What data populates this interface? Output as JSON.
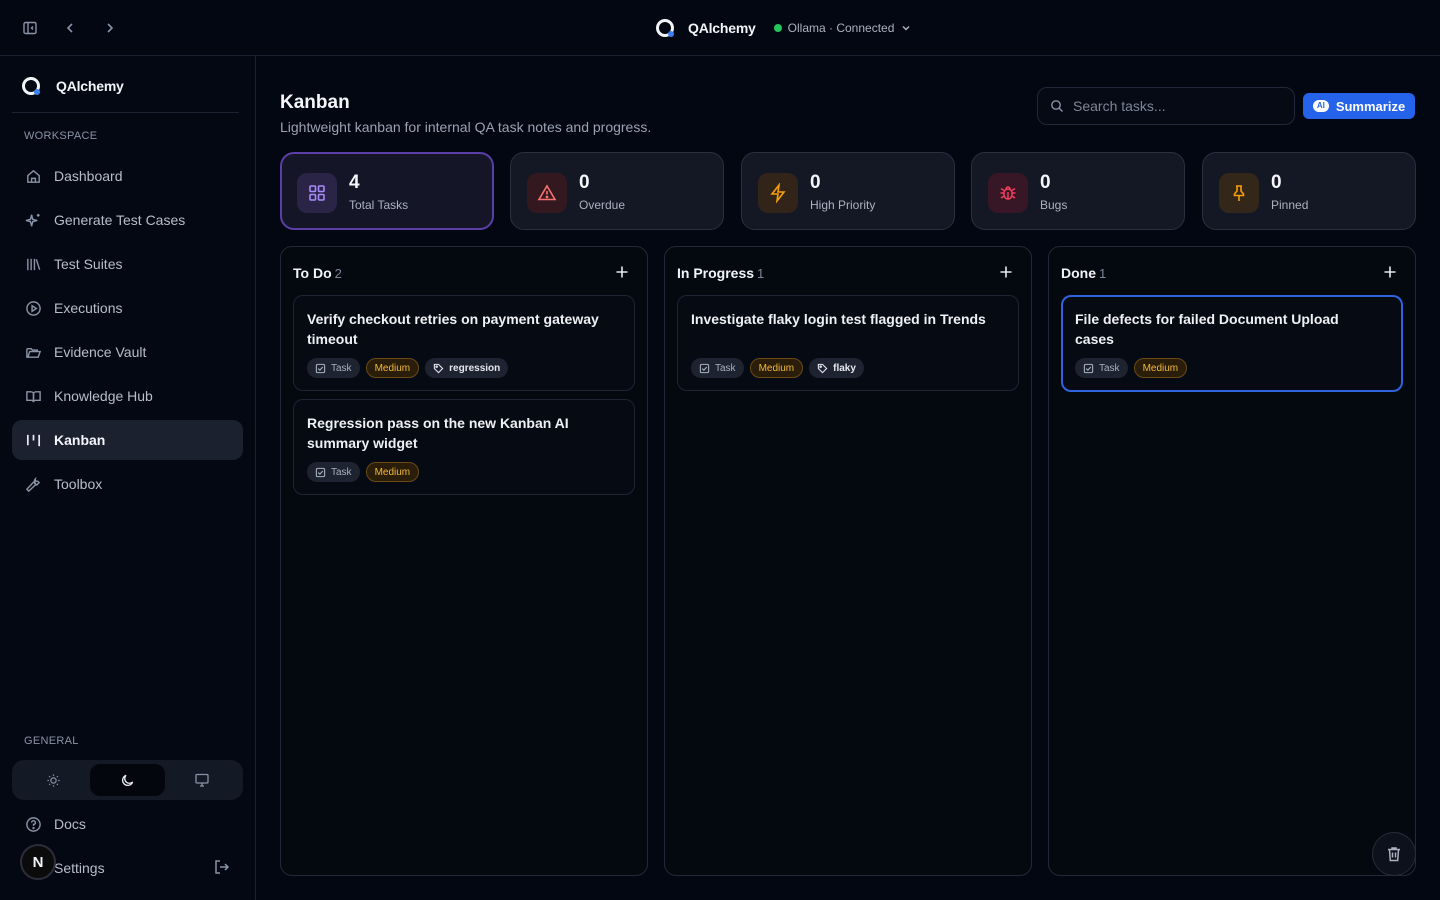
{
  "titlebar": {
    "app_name": "QAlchemy",
    "status": "Ollama · Connected"
  },
  "sidebar": {
    "brand": "QAlchemy",
    "workspace_label": "WORKSPACE",
    "items": [
      {
        "label": "Dashboard",
        "icon": "home-icon"
      },
      {
        "label": "Generate Test Cases",
        "icon": "sparkles-icon"
      },
      {
        "label": "Test Suites",
        "icon": "library-icon"
      },
      {
        "label": "Executions",
        "icon": "play-circle-icon"
      },
      {
        "label": "Evidence Vault",
        "icon": "folder-open-icon"
      },
      {
        "label": "Knowledge Hub",
        "icon": "book-open-icon"
      },
      {
        "label": "Kanban",
        "icon": "kanban-icon",
        "active": true
      },
      {
        "label": "Toolbox",
        "icon": "wrench-icon"
      }
    ],
    "general_label": "GENERAL",
    "theme_selected": "dark",
    "docs_label": "Docs",
    "settings_label": "Settings",
    "avatar_initial": "N"
  },
  "main": {
    "title": "Kanban",
    "subtitle": "Lightweight kanban for internal QA task notes and progress.",
    "search_placeholder": "Search tasks...",
    "summarize_label": "Summarize",
    "ai_badge": "AI",
    "stats": [
      {
        "value": "4",
        "label": "Total Tasks",
        "icon": "grid-icon",
        "color": "#a78bfa",
        "selected": true
      },
      {
        "value": "0",
        "label": "Overdue",
        "icon": "alert-triangle-icon",
        "color": "#f87171"
      },
      {
        "value": "0",
        "label": "High Priority",
        "icon": "zap-icon",
        "color": "#f59e0b"
      },
      {
        "value": "0",
        "label": "Bugs",
        "icon": "bug-icon",
        "color": "#f43f5e"
      },
      {
        "value": "0",
        "label": "Pinned",
        "icon": "pin-icon",
        "color": "#f59e0b"
      }
    ],
    "columns": [
      {
        "title": "To Do",
        "count": "2",
        "cards": [
          {
            "title": "Verify checkout retries on payment gateway timeout",
            "type": "Task",
            "priority": "Medium",
            "label": "regression"
          },
          {
            "title": "Regression pass on the new Kanban AI summary widget",
            "type": "Task",
            "priority": "Medium"
          }
        ]
      },
      {
        "title": "In Progress",
        "count": "1",
        "cards": [
          {
            "title": "Investigate flaky login test flagged in Trends",
            "type": "Task",
            "priority": "Medium",
            "label": "flaky"
          }
        ]
      },
      {
        "title": "Done",
        "count": "1",
        "cards": [
          {
            "title": "File defects for failed Document Upload cases",
            "type": "Task",
            "priority": "Medium",
            "selected": true
          }
        ]
      }
    ]
  }
}
